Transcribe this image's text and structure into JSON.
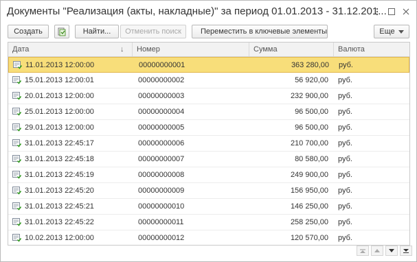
{
  "window": {
    "title": "Документы \"Реализация (акты, накладные)\" за период 01.01.2013 - 31.12.201...",
    "menu_icon": "kebab-menu-icon",
    "maximize_icon": "maximize-icon",
    "close_icon": "close-icon"
  },
  "toolbar": {
    "create_label": "Создать",
    "copy_icon": "copy-document-icon",
    "find_label": "Найти...",
    "cancel_search_label": "Отменить поиск",
    "move_key_label": "Переместить в ключевые элементы",
    "move_key_icon": "key-icon",
    "more_label": "Еще"
  },
  "table": {
    "columns": [
      "Дата",
      "Номер",
      "Сумма",
      "Валюта"
    ],
    "sort_icon": "sort-arrow-down-icon",
    "rows": [
      {
        "date": "11.01.2013 12:00:00",
        "number": "00000000001",
        "sum": "363 280,00",
        "currency": "руб."
      },
      {
        "date": "15.01.2013 12:00:01",
        "number": "00000000002",
        "sum": "56 920,00",
        "currency": "руб."
      },
      {
        "date": "20.01.2013 12:00:00",
        "number": "00000000003",
        "sum": "232 900,00",
        "currency": "руб."
      },
      {
        "date": "25.01.2013 12:00:00",
        "number": "00000000004",
        "sum": "96 500,00",
        "currency": "руб."
      },
      {
        "date": "29.01.2013 12:00:00",
        "number": "00000000005",
        "sum": "96 500,00",
        "currency": "руб."
      },
      {
        "date": "31.01.2013 22:45:17",
        "number": "00000000006",
        "sum": "210 700,00",
        "currency": "руб."
      },
      {
        "date": "31.01.2013 22:45:18",
        "number": "00000000007",
        "sum": "80 580,00",
        "currency": "руб."
      },
      {
        "date": "31.01.2013 22:45:19",
        "number": "00000000008",
        "sum": "249 900,00",
        "currency": "руб."
      },
      {
        "date": "31.01.2013 22:45:20",
        "number": "00000000009",
        "sum": "156 950,00",
        "currency": "руб."
      },
      {
        "date": "31.01.2013 22:45:21",
        "number": "00000000010",
        "sum": "146 250,00",
        "currency": "руб."
      },
      {
        "date": "31.01.2013 22:45:22",
        "number": "00000000011",
        "sum": "258 250,00",
        "currency": "руб."
      },
      {
        "date": "10.02.2013 12:00:00",
        "number": "00000000012",
        "sum": "120 570,00",
        "currency": "руб."
      }
    ],
    "row_icon": "posted-document-icon",
    "selected_row": 0
  },
  "colors": {
    "selection": "#f8de7a",
    "selection_border": "#e3b64a"
  }
}
